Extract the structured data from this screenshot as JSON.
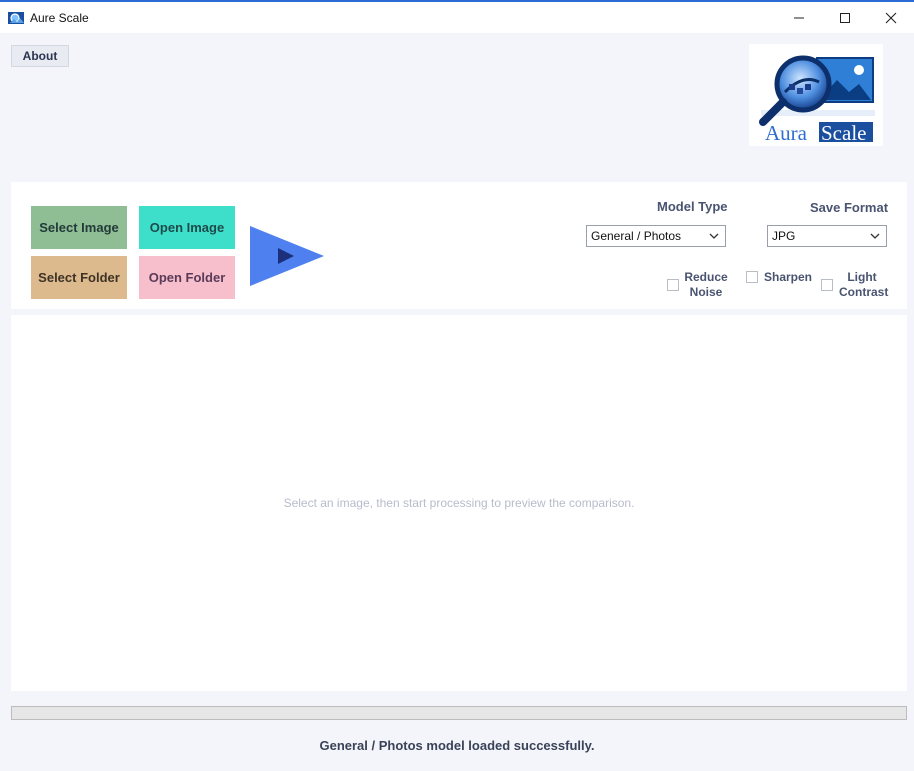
{
  "window": {
    "title": "Aure Scale",
    "controls": {
      "minimize": "—",
      "maximize": "☐",
      "close": "✕"
    }
  },
  "header": {
    "about_label": "About",
    "logo": {
      "word1": "Aura",
      "word2": "Scale"
    }
  },
  "toolbar": {
    "select_image_label": "Select Image",
    "open_image_label": "Open Image",
    "select_folder_label": "Select Folder",
    "open_folder_label": "Open Folder",
    "model_type_label": "Model Type",
    "model_type_value": "General / Photos",
    "save_format_label": "Save Format",
    "save_format_value": "JPG",
    "options": {
      "reduce_noise_line1": "Reduce",
      "reduce_noise_line2": "Noise",
      "sharpen": "Sharpen",
      "light_contrast_line1": "Light",
      "light_contrast_line2": "Contrast"
    },
    "checked": {
      "reduce_noise": false,
      "sharpen": false,
      "light_contrast": false
    }
  },
  "preview": {
    "placeholder": "Select an image, then start processing to preview the comparison."
  },
  "progress": {
    "value": 0
  },
  "status": {
    "message": "General / Photos model loaded successfully."
  },
  "colors": {
    "select_image": "#8fbe94",
    "open_image": "#3ddfcb",
    "select_folder": "#ddb98e",
    "open_folder": "#f7bfcb",
    "play": "#4e80f0"
  },
  "icons": {
    "app": "app-logo-icon",
    "play": "play-icon",
    "dropdown": "chevron-down-icon"
  }
}
